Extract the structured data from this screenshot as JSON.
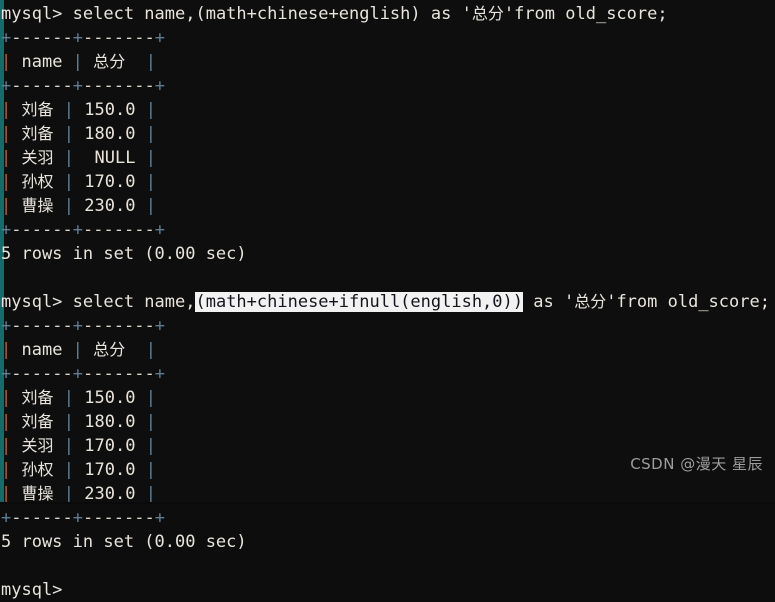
{
  "terminal": {
    "title": "mysql client session",
    "prompt": "mysql> ",
    "colors": {
      "background": "#0e0e0e",
      "foreground": "#e8e4dc",
      "left_strip": "#146b6b",
      "table_pipe": "#5f7d94",
      "table_rule": "#d9d5cd",
      "selection_bg": "#f2f2f2",
      "selection_fg": "#15151e",
      "watermark": "#9d9d9d"
    }
  },
  "lines": {
    "l01_prompt": "mysql> ",
    "l01_query": "select name,(math+chinese+english) as '总分'from old_score;",
    "l02_rule": "+------+-------+",
    "l03_header": "| name | 总分  |",
    "l04_rule": "+------+-------+",
    "l05_row": "| 刘备 | 150.0 |",
    "l06_row": "| 刘备 | 180.0 |",
    "l07_row": "| 关羽 |  NULL |",
    "l08_row": "| 孙权 | 170.0 |",
    "l09_row": "| 曹操 | 230.0 |",
    "l10_rule": "+------+-------+",
    "l11_status": "5 rows in set (0.00 sec)",
    "l12_blank": " ",
    "l13_prompt": "mysql> ",
    "l13_pre": "select name,",
    "l13_selected": "(math+chinese+ifnull(english,0))",
    "l13_post": " as '总分'from old_score;",
    "l14_rule": "+------+-------+",
    "l15_header": "| name | 总分  |",
    "l16_rule": "+------+-------+",
    "l17_row": "| 刘备 | 150.0 |",
    "l18_row": "| 刘备 | 180.0 |",
    "l19_row": "| 关羽 | 170.0 |",
    "l20_row": "| 孙权 | 170.0 |",
    "l21_row": "| 曹操 | 230.0 |",
    "l22_rule": "+------+-------+",
    "l23_status": "5 rows in set (0.00 sec)",
    "l24_blank": " ",
    "l25_prompt": "mysql>"
  },
  "query_1": {
    "sql": "select name,(math+chinese+english) as '总分'from old_score;",
    "status": "5 rows in set (0.00 sec)",
    "row_count": 5,
    "elapsed": "0.00 sec",
    "columns": [
      "name",
      "总分"
    ],
    "rows": [
      [
        "刘备",
        "150.0"
      ],
      [
        "刘备",
        "180.0"
      ],
      [
        "关羽",
        "NULL"
      ],
      [
        "孙权",
        "170.0"
      ],
      [
        "曹操",
        "230.0"
      ]
    ]
  },
  "query_2": {
    "sql": "select name,(math+chinese+ifnull(english,0)) as '总分'from old_score;",
    "highlighted_expression": "(math+chinese+ifnull(english,0))",
    "status": "5 rows in set (0.00 sec)",
    "row_count": 5,
    "elapsed": "0.00 sec",
    "columns": [
      "name",
      "总分"
    ],
    "rows": [
      [
        "刘备",
        "150.0"
      ],
      [
        "刘备",
        "180.0"
      ],
      [
        "关羽",
        "170.0"
      ],
      [
        "孙权",
        "170.0"
      ],
      [
        "曹操",
        "230.0"
      ]
    ]
  },
  "watermark": {
    "text": "CSDN @漫天 星辰"
  }
}
